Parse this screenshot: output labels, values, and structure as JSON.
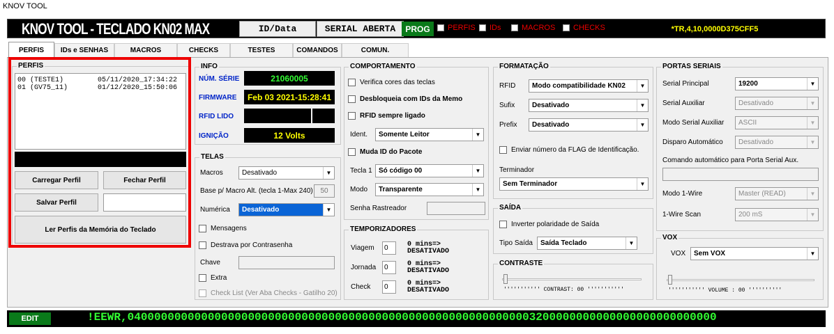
{
  "window_title": "KNOV TOOL",
  "header": {
    "title": "KNOV TOOL - TECLADO KN02 MAX",
    "id_data": "ID/Data",
    "serial_aberta": "SERIAL ABERTA",
    "prog": "PROG",
    "checks": [
      "PERFIS",
      "IDs",
      "MACROS",
      "CHECKS"
    ],
    "serial_string": "*TR,4,10,0000D375CFF5"
  },
  "tabs": [
    "PERFIS",
    "IDs e SENHAS",
    "MACROS",
    "CHECKS",
    "TESTES",
    "COMANDOS",
    "COMUN."
  ],
  "perfis": {
    "title": "PERFIS",
    "items": [
      {
        "id": "00 (TESTE1)",
        "date": "05/11/2020_17:34:22"
      },
      {
        "id": "01 (GV75_11)",
        "date": "01/12/2020_15:50:06"
      }
    ],
    "carregar": "Carregar Perfil",
    "fechar": "Fechar Perfil",
    "salvar": "Salvar Perfil",
    "ler": "Ler Perfis da Memória do Teclado"
  },
  "info": {
    "title": "INFO",
    "num_serie_label": "NÚM. SÉRIE",
    "num_serie": "21060005",
    "firmware_label": "FIRMWARE",
    "firmware": "Feb 03 2021-15:28:41",
    "rfid_label": "RFID LIDO",
    "ignicao_label": "IGNIÇÃO",
    "ignicao": "12 Volts"
  },
  "telas": {
    "title": "TELAS",
    "macros_label": "Macros",
    "macros": "Desativado",
    "base_label": "Base p/ Macro Alt. (tecla 1-Max 240)",
    "base": "50",
    "numerica_label": "Numérica",
    "numerica": "Desativado",
    "mensagens": "Mensagens",
    "destrava": "Destrava por Contrasenha",
    "chave_label": "Chave",
    "extra": "Extra",
    "checklist": "Check List (Ver Aba Checks - Gatilho 20)"
  },
  "comportamento": {
    "title": "COMPORTAMENTO",
    "verifica": "Verifica cores das teclas",
    "desbloqueia": "Desbloqueia com IDs da Memo",
    "rfid": "RFID sempre ligado",
    "ident_label": "Ident.",
    "ident": "Somente Leitor",
    "muda_id": "Muda ID do Pacote",
    "tecla1_label": "Tecla 1",
    "tecla1": "Só código 00",
    "modo_label": "Modo",
    "modo": "Transparente",
    "senha_label": "Senha Rastreador"
  },
  "temporizadores": {
    "title": "TEMPORIZADORES",
    "rows": [
      {
        "label": "Viagem",
        "value": "0",
        "text1": "0 mins=>",
        "text2": "DESATIVADO"
      },
      {
        "label": "Jornada",
        "value": "0",
        "text1": "0 mins=>",
        "text2": "DESATIVADO"
      },
      {
        "label": "Check",
        "value": "0",
        "text1": "0 mins=>",
        "text2": "DESATIVADO"
      }
    ]
  },
  "formatacao": {
    "title": "FORMATAÇÃO",
    "rfid_label": "RFID",
    "rfid": "Modo compatibilidade KN02",
    "sufix_label": "Sufix",
    "sufix": "Desativado",
    "prefix_label": "Prefix",
    "prefix": "Desativado",
    "enviar": "Enviar número da FLAG de Identificação.",
    "terminador_label": "Terminador",
    "terminador": "Sem Terminador"
  },
  "saida": {
    "title": "SAÍDA",
    "inverter": "Inverter polaridade de Saída",
    "tipo_label": "Tipo Saída",
    "tipo": "Saída Teclado"
  },
  "contraste": {
    "title": "CONTRASTE",
    "text": "CONTRAST: 00",
    "value": 0
  },
  "portas": {
    "title": "PORTAS SERIAIS",
    "principal_label": "Serial Principal",
    "principal": "19200",
    "auxiliar_label": "Serial Auxiliar",
    "auxiliar": "Desativado",
    "modo_aux_label": "Modo Serial Auxiliar",
    "modo_aux": "ASCII",
    "disparo_label": "Disparo Automático",
    "disparo": "Desativado",
    "comando_label": "Comando automático  para Porta Serial Aux.",
    "onewire_label": "Modo 1-Wire",
    "onewire": "Master (READ)",
    "scan_label": "1-Wire Scan",
    "scan": "200 mS"
  },
  "vox": {
    "title": "VOX",
    "label": "VOX",
    "value": "Sem VOX",
    "volume_text": "VOLUME : 00",
    "volume": 0
  },
  "footer": {
    "edit": "EDIT",
    "eewr": "!EEWR,0400000000000000000000000000000000000000000000000000000000003200000000000000000000000000"
  },
  "colors": {
    "prog_green": "#0a7a1a",
    "display_yellow": "#ffff00",
    "display_green": "#33ff33",
    "highlight_red": "#ee0000"
  }
}
